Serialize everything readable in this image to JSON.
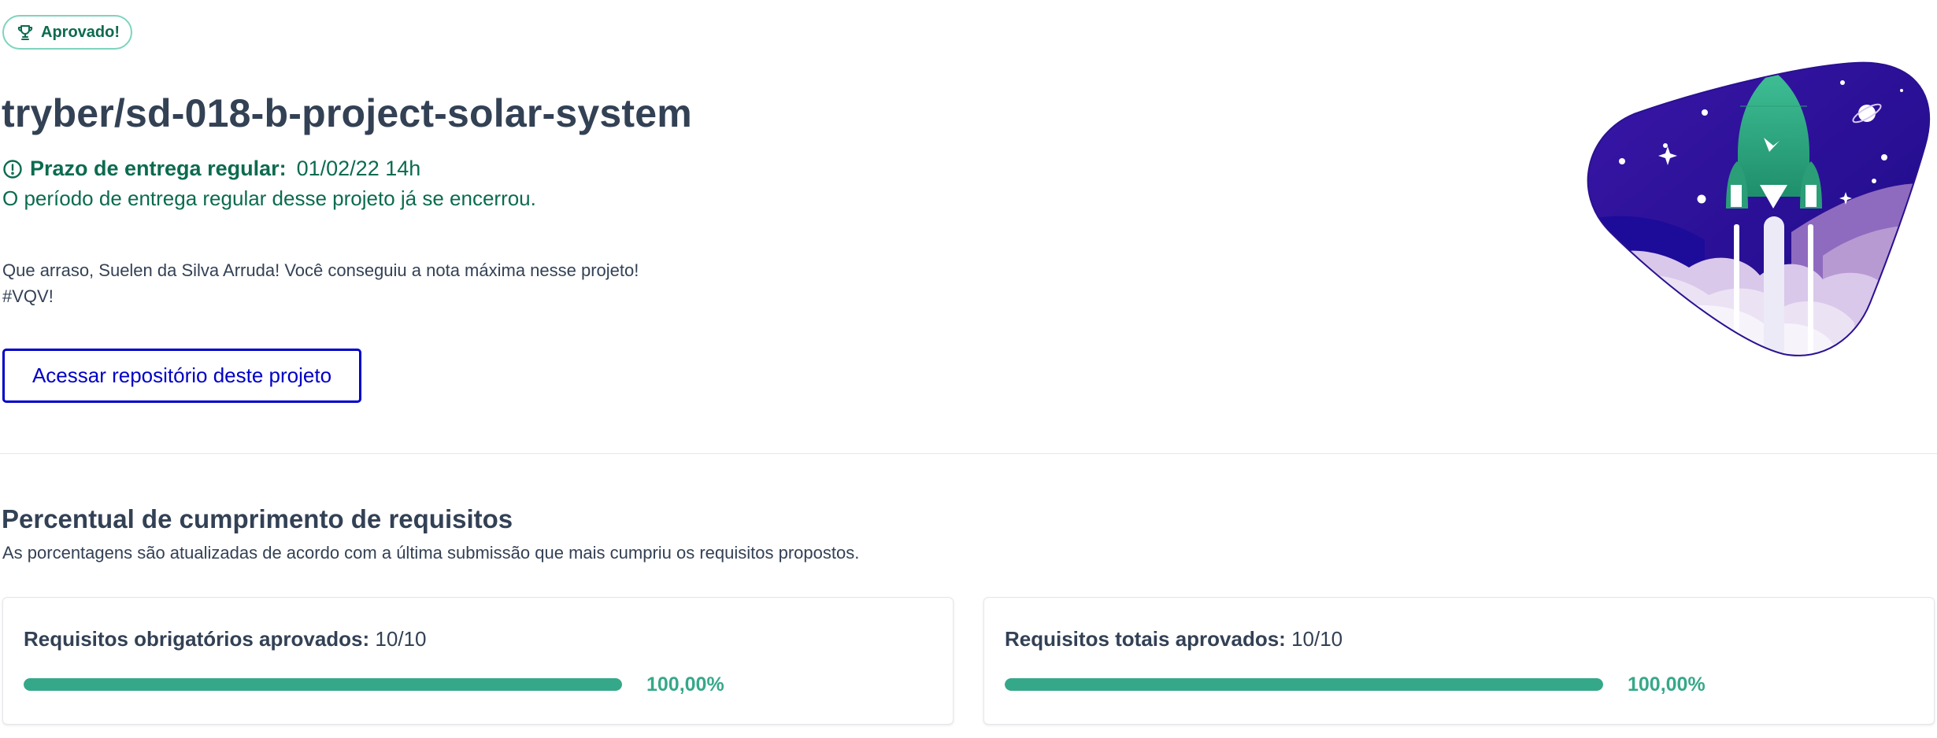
{
  "status_badge": {
    "icon": "trophy-icon",
    "label": "Aprovado!"
  },
  "project": {
    "title": "tryber/sd-018-b-project-solar-system",
    "deadline_icon": "alert-circle-icon",
    "deadline_label": "Prazo de entrega regular:",
    "deadline_value": "01/02/22 14h",
    "deadline_notice": "O período de entrega regular desse projeto já se encerrou.",
    "congrats_line1": "Que arraso, Suelen da Silva Arruda! Você conseguiu a nota máxima nesse projeto!",
    "congrats_line2": "#VQV!",
    "repo_button_label": "Acessar repositório deste projeto"
  },
  "requirements": {
    "title": "Percentual de cumprimento de requisitos",
    "subtitle": "As porcentagens são atualizadas de acordo com a última submissão que mais cumpriu os requisitos propostos.",
    "cards": [
      {
        "label": "Requisitos obrigatórios aprovados:",
        "count": "10/10",
        "percent_text": "100,00%",
        "progress": 1.0
      },
      {
        "label": "Requisitos totais aprovados:",
        "count": "10/10",
        "percent_text": "100,00%",
        "progress": 1.0
      }
    ]
  },
  "illustration": {
    "icon": "rocket-launch-illustration"
  },
  "colors": {
    "brand_green": "#0b6b4f",
    "progress_green": "#36a88a",
    "primary_blue": "#0000c8",
    "text_dark": "#334155",
    "night_sky": "#24108f"
  }
}
